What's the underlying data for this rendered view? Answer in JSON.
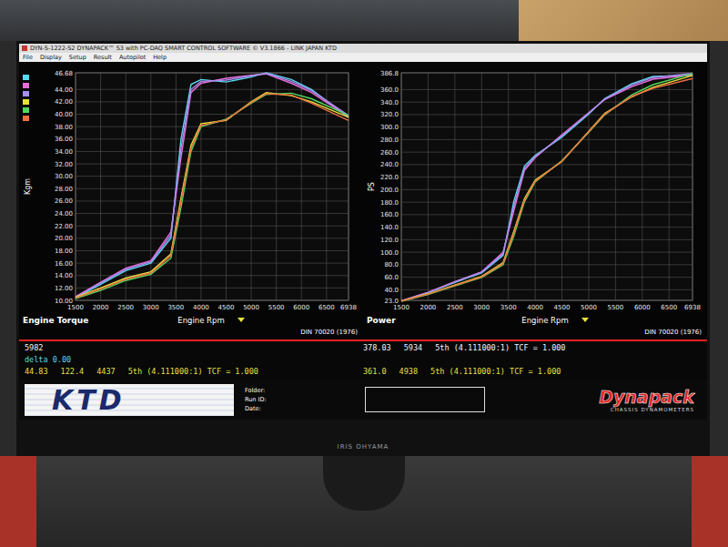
{
  "window": {
    "title": "DYN-S-1222-S2 DYNAPACK™ S3 with PC-DAQ SMART CONTROL SOFTWARE © V3.1866 - LINK JAPAN KTD"
  },
  "menu": [
    "File",
    "Display",
    "Setup",
    "Result",
    "Autopilot",
    "Help"
  ],
  "rpm": [
    1500,
    2000,
    2500,
    3000,
    3400,
    3600,
    3800,
    4000,
    4500,
    5000,
    5300,
    5800,
    6200,
    6938
  ],
  "charts": [
    {
      "title": "Engine Torque",
      "axis_label": "Kgm",
      "x_label": "Engine Rpm",
      "standard": "DIN 70020 (1976)",
      "y_ticks": [
        "46.68",
        "44.00",
        "42.00",
        "40.00",
        "38.00",
        "36.00",
        "34.00",
        "32.00",
        "30.00",
        "28.00",
        "26.00",
        "24.00",
        "22.00",
        "20.00",
        "18.00",
        "16.00",
        "14.00",
        "12.00",
        "10.00"
      ],
      "x_ticks": [
        "1500",
        "2000",
        "2500",
        "3000",
        "3500",
        "4000",
        "4500",
        "5000",
        "5500",
        "6000",
        "6500",
        "6938"
      ],
      "series": [
        {
          "color": "#5ad8f0",
          "values": [
            10.4,
            12.6,
            14.8,
            16.0,
            20.0,
            36.0,
            44.8,
            45.6,
            45.2,
            46.0,
            46.7,
            45.6,
            44.0,
            39.5
          ]
        },
        {
          "color": "#e86cd8",
          "values": [
            10.6,
            12.9,
            15.2,
            16.4,
            21.0,
            33.0,
            43.5,
            45.0,
            45.8,
            46.3,
            46.5,
            45.0,
            43.5,
            39.6
          ]
        },
        {
          "color": "#a98cf0",
          "values": [
            10.5,
            12.8,
            15.0,
            16.2,
            20.5,
            34.5,
            44.0,
            45.3,
            45.5,
            46.2,
            46.6,
            45.3,
            43.8,
            39.8
          ]
        },
        {
          "color": "#e8e040",
          "values": [
            10.5,
            12.0,
            13.6,
            14.6,
            17.5,
            26.5,
            35.0,
            38.5,
            39.0,
            42.0,
            43.5,
            43.0,
            42.0,
            39.5
          ]
        },
        {
          "color": "#50d860",
          "values": [
            10.3,
            11.6,
            13.2,
            14.2,
            16.8,
            25.0,
            34.0,
            38.0,
            39.2,
            41.8,
            43.2,
            43.4,
            42.5,
            39.8
          ]
        },
        {
          "color": "#f07040",
          "values": [
            10.4,
            11.8,
            13.4,
            14.4,
            17.2,
            26.0,
            34.5,
            38.2,
            39.1,
            41.9,
            43.3,
            43.1,
            41.8,
            39.0
          ]
        }
      ]
    },
    {
      "title": "Power",
      "axis_label": "PS",
      "x_label": "Engine Rpm",
      "standard": "DIN 70020 (1976)",
      "y_ticks": [
        "386.8",
        "360.0",
        "340.0",
        "320.0",
        "300.0",
        "280.0",
        "260.0",
        "240.0",
        "220.0",
        "200.0",
        "180.0",
        "160.0",
        "140.0",
        "120.0",
        "100.0",
        "80.0",
        "60.0",
        "40.0",
        "23.0"
      ],
      "x_ticks": [
        "1500",
        "2000",
        "2500",
        "3000",
        "3500",
        "4000",
        "4500",
        "5000",
        "5500",
        "6000",
        "6500",
        "6938"
      ],
      "series": [
        {
          "color": "#5ad8f0",
          "values": [
            22.0,
            35.2,
            51.7,
            67.0,
            95.0,
            181.0,
            237.7,
            254.7,
            284.0,
            321.0,
            345.6,
            369.0,
            381.0,
            382.6
          ]
        },
        {
          "color": "#e86cd8",
          "values": [
            22.2,
            36.0,
            53.0,
            68.7,
            99.7,
            166.0,
            230.8,
            251.0,
            287.8,
            323.0,
            344.0,
            364.5,
            376.6,
            383.6
          ]
        },
        {
          "color": "#a98cf0",
          "values": [
            22.0,
            35.7,
            52.4,
            67.9,
            97.3,
            173.4,
            233.5,
            253.0,
            285.9,
            322.5,
            344.9,
            366.9,
            379.2,
            385.6
          ]
        },
        {
          "color": "#e8e040",
          "values": [
            22.0,
            33.5,
            47.5,
            61.2,
            83.1,
            133.2,
            185.7,
            215.0,
            245.0,
            293.2,
            321.9,
            348.2,
            363.6,
            382.6
          ]
        },
        {
          "color": "#50d860",
          "values": [
            21.6,
            32.4,
            46.1,
            59.5,
            79.8,
            125.7,
            180.4,
            212.2,
            246.3,
            291.8,
            319.7,
            351.5,
            367.9,
            385.6
          ]
        },
        {
          "color": "#f07040",
          "values": [
            21.8,
            33.0,
            46.8,
            60.3,
            81.6,
            130.7,
            183.0,
            213.4,
            245.7,
            292.5,
            320.4,
            349.0,
            361.9,
            377.8
          ]
        }
      ]
    }
  ],
  "readouts": [
    {
      "color": "#f4f4f4",
      "left": [
        "5982"
      ],
      "right": [
        "378.03",
        "5934",
        "5th (4.111000:1) TCF = 1.000"
      ]
    },
    {
      "color": "#5ad8f0",
      "left": [
        "delta 0.00"
      ],
      "right": []
    },
    {
      "color": "#e8e040",
      "left": [
        "44.83",
        "122.4",
        "4437",
        "5th (4.111000:1) TCF = 1.000"
      ],
      "right": [
        "361.0",
        "4938",
        "5th (4.111000:1) TCF = 1.000"
      ]
    }
  ],
  "footer": {
    "logo": "KTD",
    "fields": [
      "Folder:",
      "Run ID:",
      "Date:"
    ],
    "brand": "Dynapack",
    "brand_sub": "CHASSIS DYNAMOMETERS"
  },
  "monitor_brand": "IRIS OHYAMA"
}
